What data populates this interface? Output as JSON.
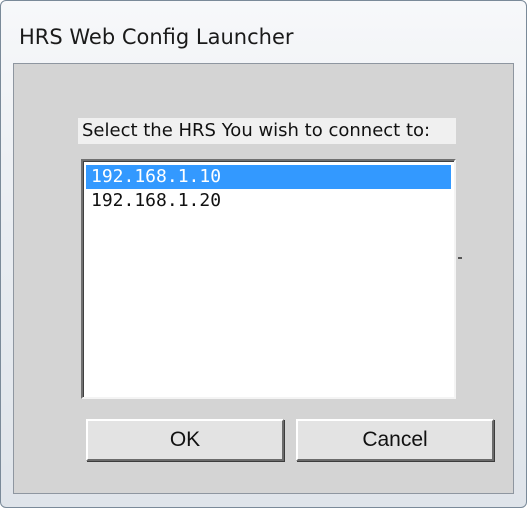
{
  "window": {
    "title": "HRS Web Config Launcher"
  },
  "dialog": {
    "prompt": "Select the HRS You wish to connect to:",
    "list_items": [
      {
        "label": "192.168.1.10",
        "selected": true
      },
      {
        "label": "192.168.1.20",
        "selected": false
      }
    ],
    "ok_label": "OK",
    "cancel_label": "Cancel"
  },
  "colors": {
    "selection": "#3399ff",
    "client_background": "#d4d4d4"
  }
}
